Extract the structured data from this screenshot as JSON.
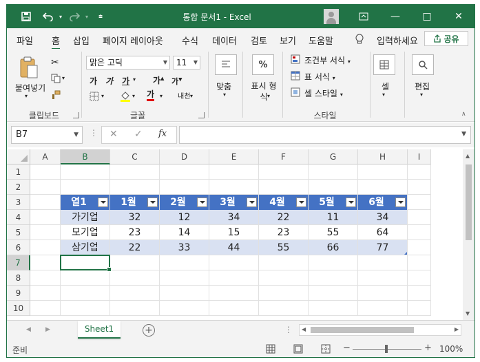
{
  "titlebar": {
    "title": "통합 문서1  -  Excel",
    "save_icon": "save-icon",
    "undo_icon": "undo-icon",
    "redo_icon": "redo-icon",
    "minimize": "—",
    "restore": "□",
    "close": "✕"
  },
  "tabs": [
    "파일",
    "홈",
    "삽입",
    "페이지 레이아웃",
    "수식",
    "데이터",
    "검토",
    "보기",
    "도움말"
  ],
  "active_tab": "홈",
  "tell_me": "입력하세요",
  "share_label": "공유",
  "ribbon": {
    "clipboard": {
      "paste": "붙여넣기",
      "group": "클립보드"
    },
    "font": {
      "name": "맑은 고딕",
      "size": "11",
      "bold": "가",
      "italic": "가",
      "underline": "가",
      "grow": "가",
      "shrink": "가",
      "fontcolor": "가",
      "phonetic": "내천",
      "group": "글꼴"
    },
    "align": {
      "label": "맞춤"
    },
    "number": {
      "label": "표시 형식",
      "symbol": "%"
    },
    "styles": {
      "conditional": "조건부 서식",
      "table": "표 서식",
      "cell": "셀 스타일",
      "group": "스타일"
    },
    "cells": {
      "label": "셀"
    },
    "editing": {
      "label": "편집"
    }
  },
  "formula_bar": {
    "name_box": "B7",
    "fx": "fx",
    "cancel": "✕",
    "enter": "✓",
    "formula": ""
  },
  "columns": [
    "A",
    "B",
    "C",
    "D",
    "E",
    "F",
    "G",
    "H",
    "I"
  ],
  "selected_column": "B",
  "rows": [
    "1",
    "2",
    "3",
    "4",
    "5",
    "6",
    "7",
    "8",
    "9",
    "10"
  ],
  "selected_row": "7",
  "table": {
    "headers": [
      "열1",
      "1월",
      "2월",
      "3월",
      "4월",
      "5월",
      "6월"
    ],
    "rows": [
      [
        "가기업",
        "32",
        "12",
        "34",
        "22",
        "11",
        "34"
      ],
      [
        "모기업",
        "23",
        "14",
        "15",
        "23",
        "55",
        "64"
      ],
      [
        "삼기업",
        "22",
        "33",
        "44",
        "55",
        "66",
        "77"
      ]
    ],
    "header_color": "#4472c4",
    "band_color": "#d9e1f2"
  },
  "sheets": [
    "Sheet1"
  ],
  "status": {
    "ready": "준비",
    "zoom": "100%",
    "minus": "−",
    "plus": "+"
  },
  "accent": "#217346"
}
